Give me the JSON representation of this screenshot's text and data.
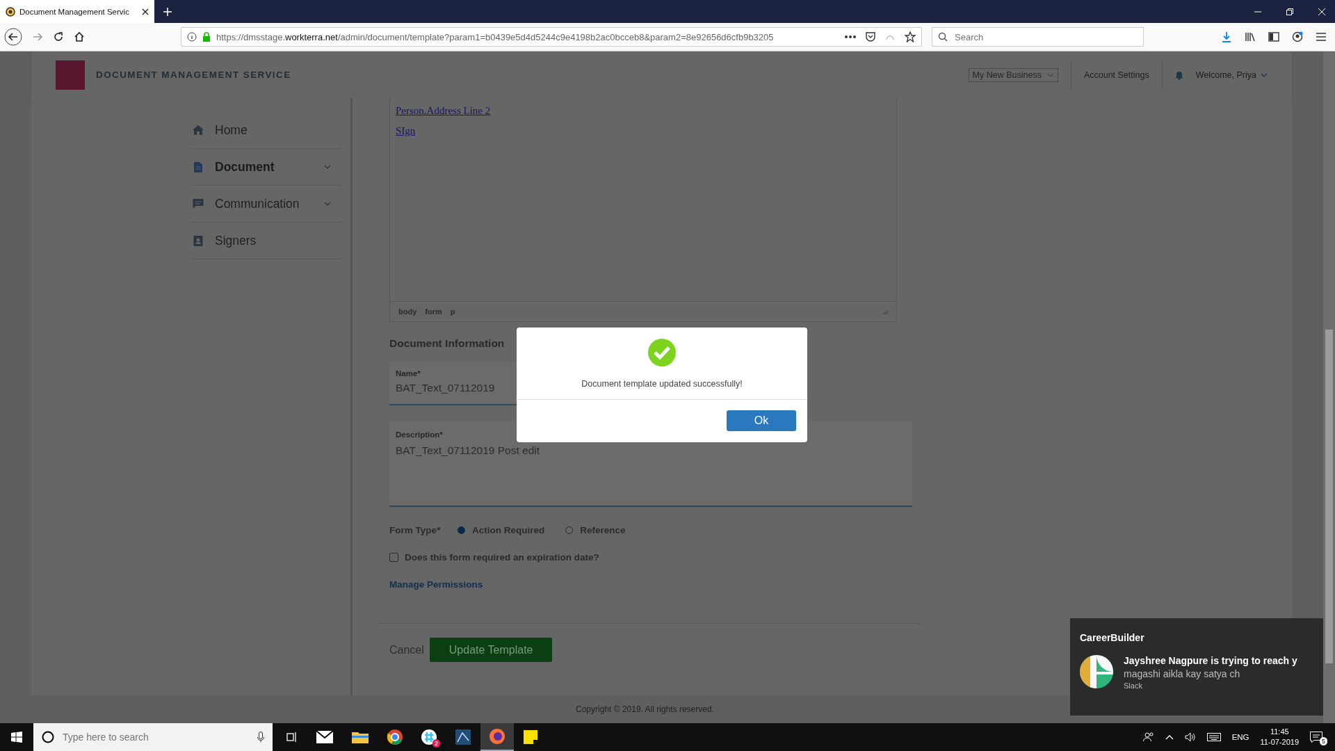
{
  "browser": {
    "tab_title": "Document Management Servic",
    "url_parts": [
      {
        "kind": "muted",
        "text": "https://dmsstage."
      },
      {
        "kind": "domain",
        "text": "workterra.net"
      },
      {
        "kind": "muted",
        "text": "/admin/document/template?param1=b0439e5d4d5244c9e4198b2ac0bcceb8&param2=8e92656d6cfb9b3205"
      }
    ],
    "search_placeholder": "Search"
  },
  "header": {
    "title": "DOCUMENT MANAGEMENT SERVICE",
    "business_select": "My New Business",
    "account_settings": "Account Settings",
    "welcome": "Welcome, Priya"
  },
  "sidebar": {
    "items": [
      {
        "kind": "home",
        "label": "Home",
        "selected": false,
        "expandable": false
      },
      {
        "kind": "document",
        "label": "Document",
        "selected": true,
        "expandable": true
      },
      {
        "kind": "communication",
        "label": "Communication",
        "selected": false,
        "expandable": true
      },
      {
        "kind": "signers",
        "label": "Signers",
        "selected": false,
        "expandable": false
      }
    ]
  },
  "editor": {
    "links": [
      "Person.Address Line 2",
      "SIgn"
    ],
    "path": [
      "body",
      "form",
      "p"
    ]
  },
  "document_info": {
    "heading": "Document Information",
    "name": {
      "label": "Name*",
      "value": "BAT_Text_07112019"
    },
    "description": {
      "label": "Description*",
      "value": "BAT_Text_07112019 Post edit"
    },
    "form_type": {
      "label": "Form Type*",
      "options": [
        {
          "label": "Action Required",
          "selected": true
        },
        {
          "label": "Reference",
          "selected": false
        }
      ]
    },
    "expiration": {
      "label": "Does this form required an expiration date?",
      "checked": false
    },
    "manage_permissions": "Manage Permissions"
  },
  "actions": {
    "cancel": "Cancel",
    "submit": "Update Template"
  },
  "footer": {
    "copyright": "Copyright © 2019. All rights reserved."
  },
  "modal": {
    "message": "Document template updated successfully!",
    "ok": "Ok"
  },
  "notification": {
    "app": "CareerBuilder",
    "title": "Jayshree Nagpure is trying to reach y",
    "message": "magashi aikla kay satya ch",
    "source": "Slack"
  },
  "taskbar": {
    "search_placeholder": "Type here to search",
    "chat_badge": "2",
    "language": "ENG",
    "time": "11:45",
    "date": "11-07-2019",
    "notification_count": "5"
  }
}
